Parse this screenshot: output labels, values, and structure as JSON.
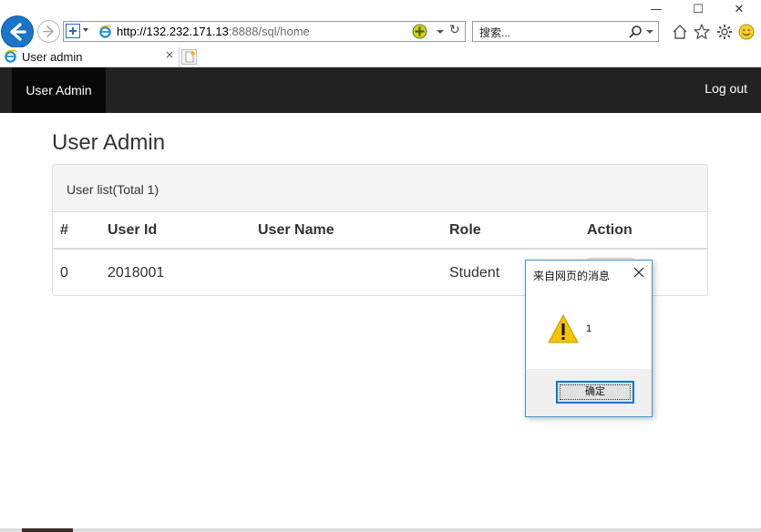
{
  "browser": {
    "url_host": "http://132.232.171.13",
    "url_rest": ":8888/sql/home",
    "search_placeholder": "搜索...",
    "tab_title": "User admin",
    "tab_close": "×",
    "window_controls": {
      "minimize": "—",
      "maximize": "☐",
      "close": "✕"
    }
  },
  "navbar": {
    "brand": "User Admin",
    "logout": "Log out",
    "bg_color": "#222222"
  },
  "page": {
    "title": "User Admin",
    "panel_heading": "User list(Total 1)",
    "columns": [
      "#",
      "User Id",
      "User Name",
      "Role",
      "Action"
    ],
    "rows": [
      {
        "index": "0",
        "user_id": "2018001",
        "user_name": "",
        "role": "Student"
      }
    ]
  },
  "dialog": {
    "title": "来自网页的消息",
    "message": "1",
    "ok_label": "确定",
    "icon": "warning-icon",
    "accent_color": "#0078d7"
  }
}
